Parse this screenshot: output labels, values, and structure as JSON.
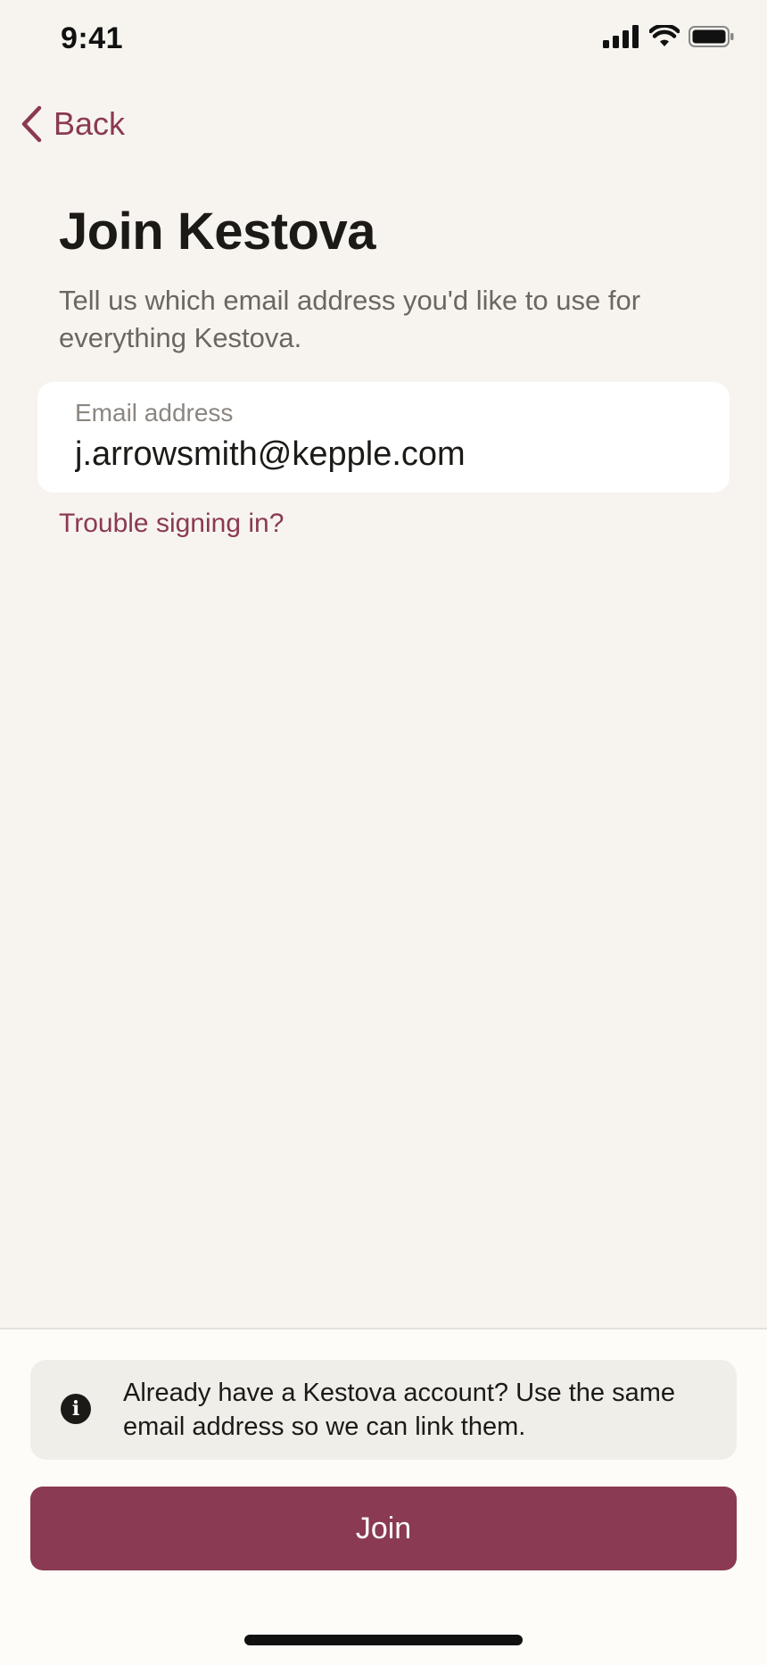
{
  "status_bar": {
    "time": "9:41",
    "icons": [
      "cellular-signal-icon",
      "wifi-icon",
      "battery-icon"
    ]
  },
  "nav": {
    "back_label": "Back",
    "back_icon": "chevron-left-icon"
  },
  "page": {
    "title": "Join Kestova",
    "subtitle": "Tell us which email address you'd like to use for everything Kestova."
  },
  "email_field": {
    "label": "Email address",
    "value": "j.arrowsmith@kepple.com"
  },
  "links": {
    "trouble": "Trouble signing in?"
  },
  "info_box": {
    "icon": "info-icon",
    "text": "Already have a Kestova account? Use the same email address so we can link them."
  },
  "actions": {
    "join_label": "Join"
  },
  "colors": {
    "accent": "#8a3a52",
    "background": "#f7f4ef",
    "card": "#ffffff",
    "info_background": "#f0eee8"
  }
}
